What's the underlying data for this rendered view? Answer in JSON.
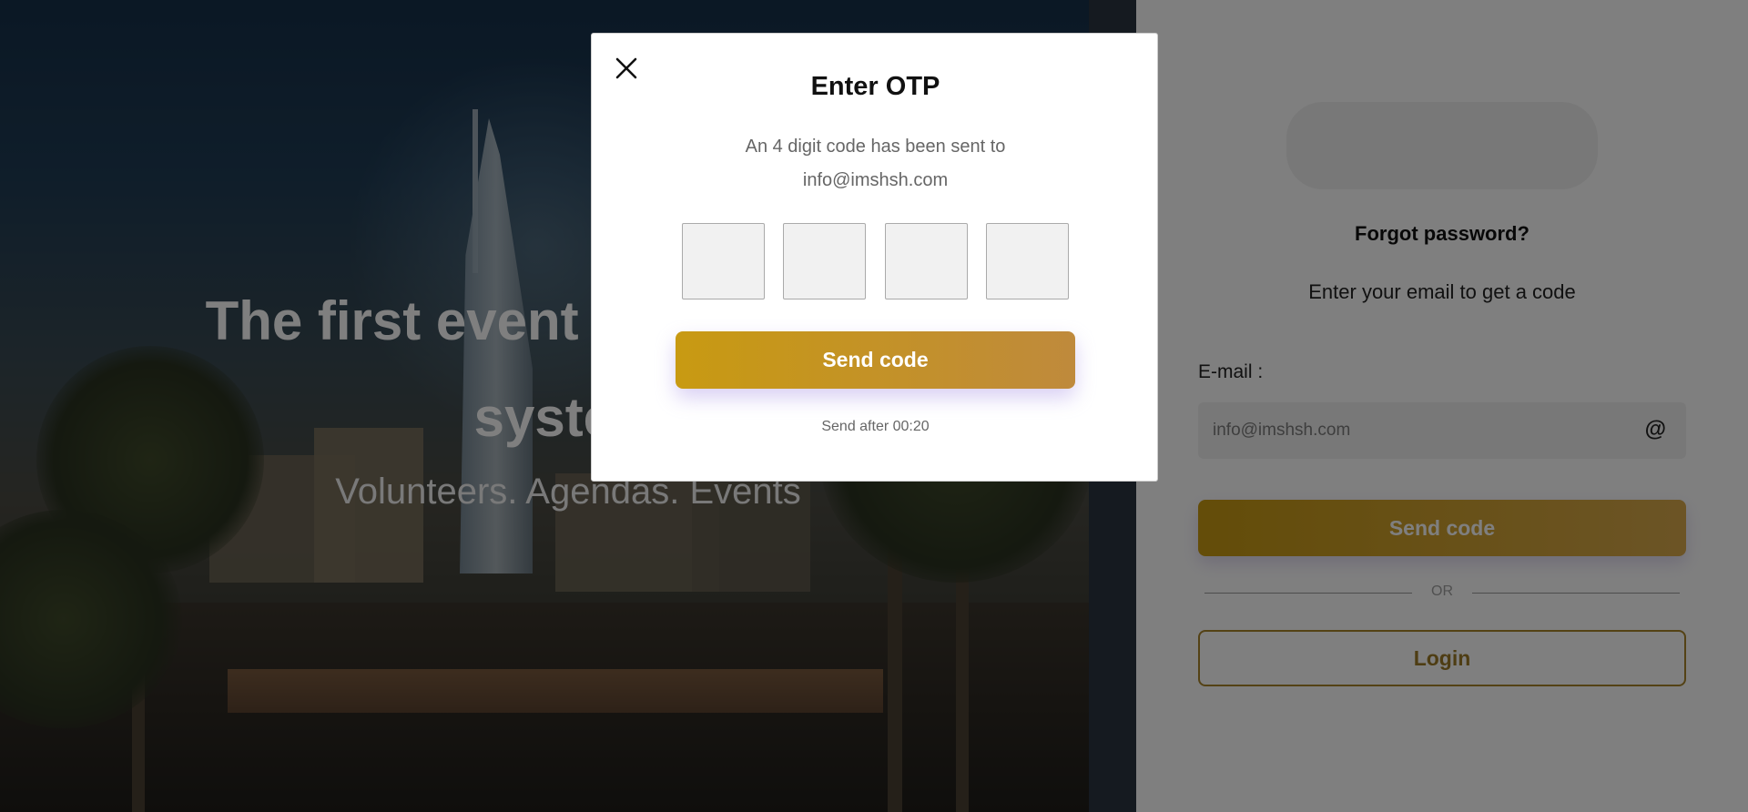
{
  "hero": {
    "title_line1": "The first event management",
    "title_line2": "system",
    "subtitle": "Volunteers. Agendas. Events"
  },
  "forgot_panel": {
    "title": "Forgot password?",
    "subtitle": "Enter your email to get a code",
    "email_label": "E-mail :",
    "email_placeholder": "info@imshsh.com",
    "email_icon": "@",
    "send_label": "Send code",
    "divider_label": "OR",
    "login_label": "Login"
  },
  "otp_modal": {
    "close_icon": "close-icon",
    "title": "Enter OTP",
    "message_line1": "An 4 digit code has been sent to",
    "message_line2": "info@imshsh.com",
    "digits": [
      "",
      "",
      "",
      ""
    ],
    "send_label": "Send code",
    "resend_text": "Send after 00:20"
  },
  "colors": {
    "accent_start": "#c89a12",
    "accent_end": "#d8a94c",
    "login_border": "#a9842a",
    "overlay": "rgba(0,0,0,0.5)"
  }
}
